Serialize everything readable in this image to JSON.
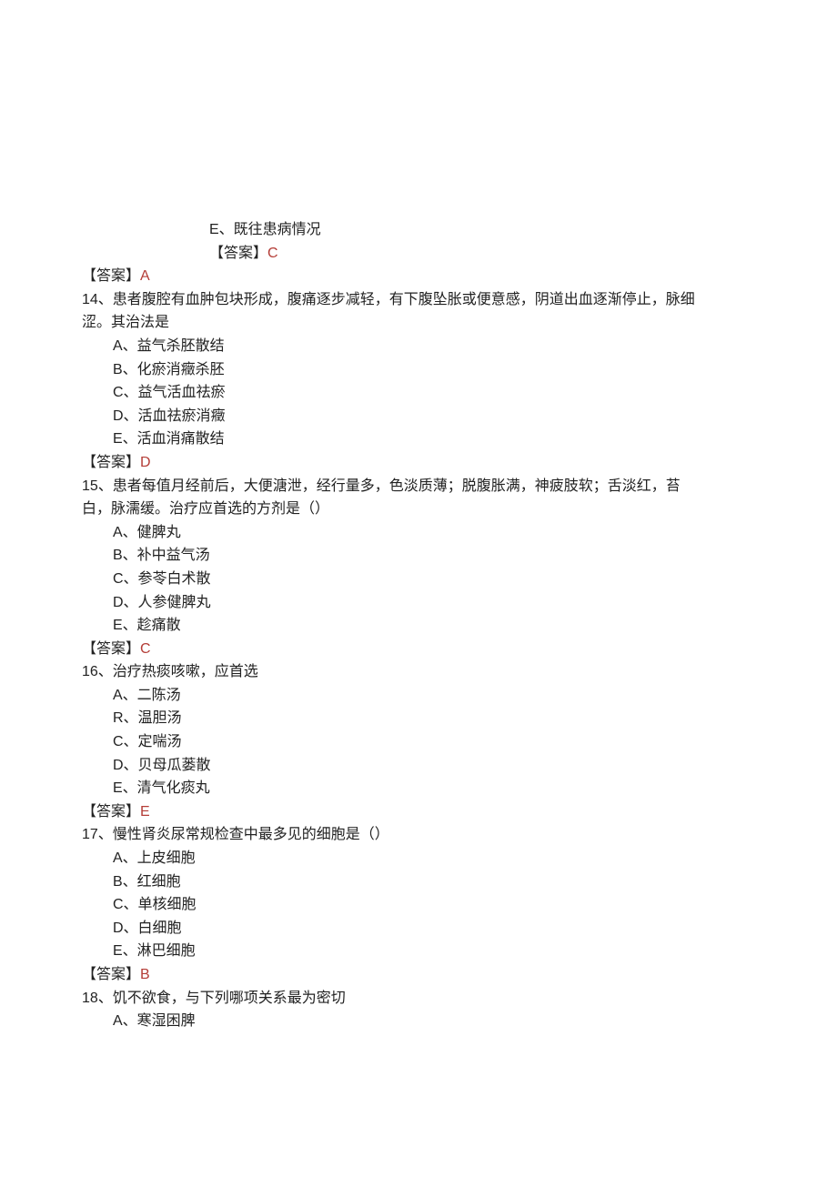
{
  "top_options": {
    "e_label": "E、既往患病情况",
    "answer_label": "【答案】",
    "answer_letter": "C",
    "answer13_label": "【答案】",
    "answer13_letter": "A"
  },
  "questions": [
    {
      "stem_lines": [
        "14、患者腹腔有血肿包块形成，腹痛逐步减轻，有下腹坠胀或便意感，阴道出血逐渐停止，脉细",
        "涩。其治法是"
      ],
      "options": [
        "A、益气杀胚散结",
        "B、化瘀消癥杀胚",
        "C、益气活血祛瘀",
        "D、活血祛瘀消癥",
        "E、活血消痛散结"
      ],
      "answer_label": "【答案】",
      "answer_letter": "D"
    },
    {
      "stem_lines": [
        "15、患者每值月经前后，大便溏泄，经行量多，色淡质薄；脱腹胀满，神疲肢软；舌淡红，苔",
        "白，脉濡缓。治疗应首选的方剂是（）"
      ],
      "options": [
        "A、健脾丸",
        "B、补中益气汤",
        "C、参苓白术散",
        "D、人参健脾丸",
        "E、趁痛散"
      ],
      "answer_label": "【答案】",
      "answer_letter": "C"
    },
    {
      "stem_lines": [
        "16、治疗热痰咳嗽，应首选"
      ],
      "options": [
        "A、二陈汤",
        "R、温胆汤",
        "C、定喘汤",
        "D、贝母瓜蒌散",
        "E、清气化痰丸"
      ],
      "answer_label": "【答案】",
      "answer_letter": "E"
    },
    {
      "stem_lines": [
        "17、慢性肾炎尿常规检查中最多见的细胞是（）"
      ],
      "options": [
        "A、上皮细胞",
        "B、红细胞",
        "C、单核细胞",
        "D、白细胞",
        "E、淋巴细胞"
      ],
      "answer_label": "【答案】",
      "answer_letter": "B"
    },
    {
      "stem_lines": [
        "18、饥不欲食，与下列哪项关系最为密切"
      ],
      "options": [
        "A、寒湿困脾"
      ]
    }
  ]
}
